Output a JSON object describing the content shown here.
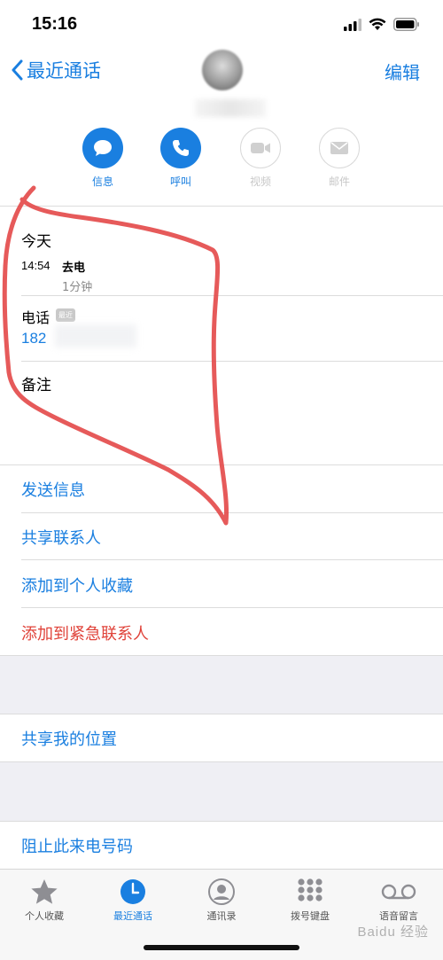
{
  "status_bar": {
    "time": "15:16"
  },
  "nav": {
    "back_label": "最近通话",
    "edit_label": "编辑"
  },
  "actions": [
    {
      "label": "信息",
      "icon": "message-icon",
      "enabled": true
    },
    {
      "label": "呼叫",
      "icon": "phone-icon",
      "enabled": true
    },
    {
      "label": "视频",
      "icon": "video-icon",
      "enabled": false
    },
    {
      "label": "邮件",
      "icon": "mail-icon",
      "enabled": false
    }
  ],
  "recent": {
    "header": "今天",
    "call_time": "14:54",
    "call_type": "去电",
    "call_duration": "1分钟"
  },
  "phone": {
    "label": "电话",
    "badge": "最近",
    "number_visible": "182"
  },
  "notes": {
    "label": "备注"
  },
  "links": {
    "send_message": "发送信息",
    "share_contact": "共享联系人",
    "add_favorites": "添加到个人收藏",
    "add_emergency": "添加到紧急联系人",
    "share_location": "共享我的位置",
    "block_caller": "阻止此来电号码"
  },
  "tabs": [
    {
      "label": "个人收藏",
      "icon": "star-icon",
      "active": false
    },
    {
      "label": "最近通话",
      "icon": "clock-icon",
      "active": true
    },
    {
      "label": "通讯录",
      "icon": "contacts-icon",
      "active": false
    },
    {
      "label": "拨号键盘",
      "icon": "keypad-icon",
      "active": false
    },
    {
      "label": "语音留言",
      "icon": "voicemail-icon",
      "active": false
    }
  ],
  "watermark": "Baidu 经验",
  "colors": {
    "accent": "#1a7fe0",
    "danger": "#e0433a",
    "annotation": "#e34848"
  }
}
